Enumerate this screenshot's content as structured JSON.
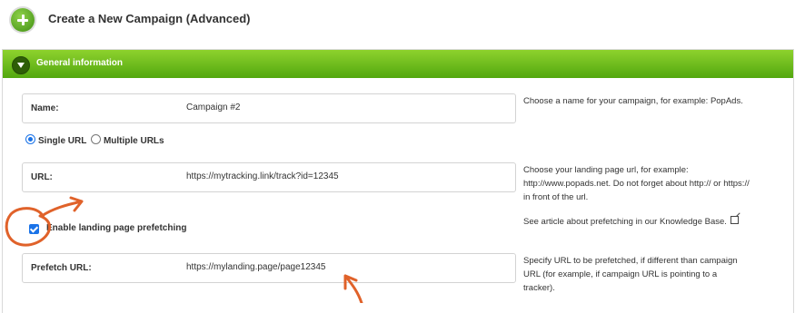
{
  "header": {
    "title": "Create a New Campaign (Advanced)"
  },
  "section": {
    "title": "General information"
  },
  "name_field": {
    "label": "Name:",
    "value": "Campaign #2",
    "help": "Choose a name for your campaign, for example: PopAds."
  },
  "url_mode": {
    "options": [
      "Single URL",
      "Multiple URLs"
    ],
    "selected": "Single URL"
  },
  "url_field": {
    "label": "URL:",
    "value": "https://mytracking.link/track?id=12345",
    "help_lines": [
      "Choose your landing page url, for example:",
      "http://www.popads.net. Do not forget about http:// or https://",
      "in front of the url."
    ]
  },
  "prefetch": {
    "checkbox_label": "Enable landing page prefetching",
    "checked": true,
    "help": "See article about prefetching in our Knowledge Base."
  },
  "prefetch_url": {
    "label": "Prefetch URL:",
    "value": "https://mylanding.page/page12345",
    "help_lines": [
      "Specify URL to be prefetched, if different than campaign",
      "URL (for example, if campaign URL is pointing to a",
      "tracker)."
    ]
  },
  "colors": {
    "accent_green": "#52a70f",
    "annotation_orange": "#e0622a",
    "checkbox_blue": "#1a73e8"
  }
}
